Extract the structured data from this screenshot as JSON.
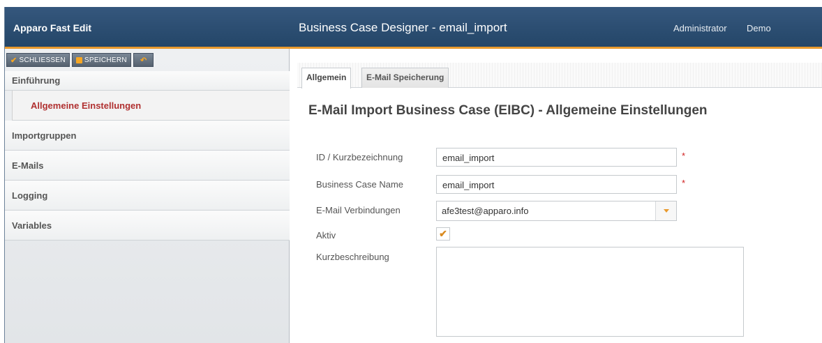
{
  "header": {
    "app_title": "Apparo Fast Edit",
    "designer_title": "Business Case Designer - email_import",
    "user_role": "Administrator",
    "user_name": "Demo"
  },
  "toolbar": {
    "close_label": "SCHLIESSEN",
    "save_label": "SPEICHERN",
    "undo_icon": "undo-arrow-icon"
  },
  "sidebar": {
    "items": [
      {
        "label": "Einführung"
      },
      {
        "label": "Allgemeine Einstellungen",
        "active": true
      },
      {
        "label": "Importgruppen"
      },
      {
        "label": "E-Mails"
      },
      {
        "label": "Logging"
      },
      {
        "label": "Variables"
      }
    ]
  },
  "tabs": [
    {
      "label": "Allgemein",
      "active": true
    },
    {
      "label": "E-Mail Speicherung",
      "active": false
    }
  ],
  "main": {
    "title": "E-Mail Import Business Case (EIBC) - Allgemeine Einstellungen",
    "fields": {
      "id_label": "ID / Kurzbezeichnung",
      "id_value": "email_import",
      "name_label": "Business Case Name",
      "name_value": "email_import",
      "connections_label": "E-Mail Verbindungen",
      "connections_value": "afe3test@apparo.info",
      "active_label": "Aktiv",
      "active_checked": true,
      "description_label": "Kurzbeschreibung",
      "description_value": "",
      "required_marker": "*"
    }
  },
  "colors": {
    "header_bg": "#2c4e74",
    "accent": "#e99a2e",
    "active_nav": "#b03030",
    "required": "#d02020"
  }
}
